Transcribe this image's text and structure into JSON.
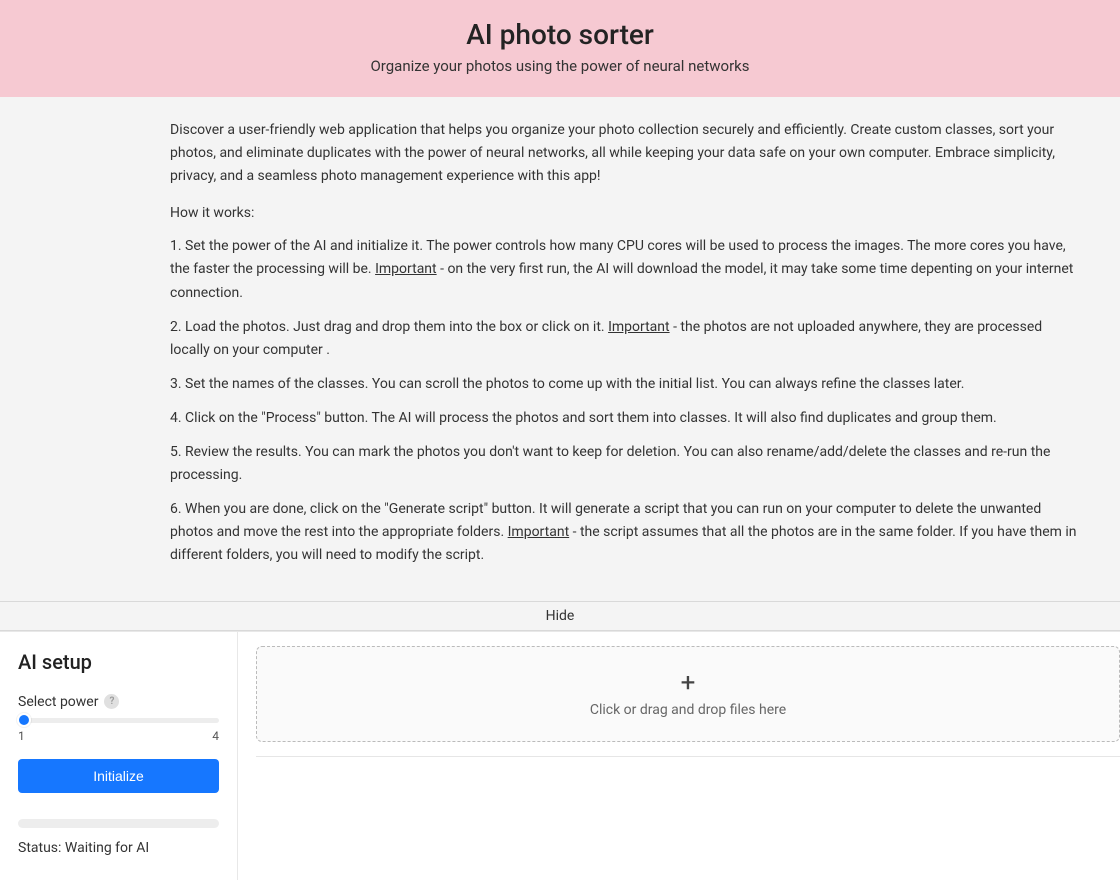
{
  "header": {
    "title": "AI photo sorter",
    "subtitle": "Organize your photos using the power of neural networks"
  },
  "intro": {
    "paragraph": "Discover a user-friendly web application that helps you organize your photo collection securely and efficiently. Create custom classes, sort your photos, and eliminate duplicates with the power of neural networks, all while keeping your data safe on your own computer. Embrace simplicity, privacy, and a seamless photo management experience with this app!",
    "how_title": "How it works:",
    "important_word": "Important",
    "steps": {
      "s1_a": "Set the power of the AI and initialize it. The power controls how many CPU cores will be used to process the images. The more cores you have, the faster the processing will be. ",
      "s1_b": " - on the very first run, the AI will download the model, it may take some time depenting on your internet connection.",
      "s2_a": "Load the photos. Just drag and drop them into the box or click on it. ",
      "s2_b": " - the photos are not uploaded anywhere, they are processed locally on your computer .",
      "s3": "Set the names of the classes. You can scroll the photos to come up with the initial list. You can always refine the classes later.",
      "s4": "Click on the \"Process\" button. The AI will process the photos and sort them into classes. It will also find duplicates and group them.",
      "s5": "Review the results. You can mark the photos you don't want to keep for deletion. You can also rename/add/delete the classes and re-run the processing.",
      "s6_a": "When you are done, click on the \"Generate script\" button. It will generate a script that you can run on your computer to delete the unwanted photos and move the rest into the appropriate folders. ",
      "s6_b": " - the script assumes that all the photos are in the same folder. If you have them in different folders, you will need to modify the script."
    }
  },
  "hide_bar": {
    "label": "Hide"
  },
  "sidebar": {
    "title": "AI setup",
    "power_label": "Select power",
    "help_symbol": "?",
    "slider": {
      "min": "1",
      "max": "4",
      "value": 1
    },
    "initialize_label": "Initialize",
    "status_prefix": "Status: ",
    "status_value": "Waiting for AI"
  },
  "dropzone": {
    "plus_symbol": "+",
    "hint": "Click or drag and drop files here"
  }
}
